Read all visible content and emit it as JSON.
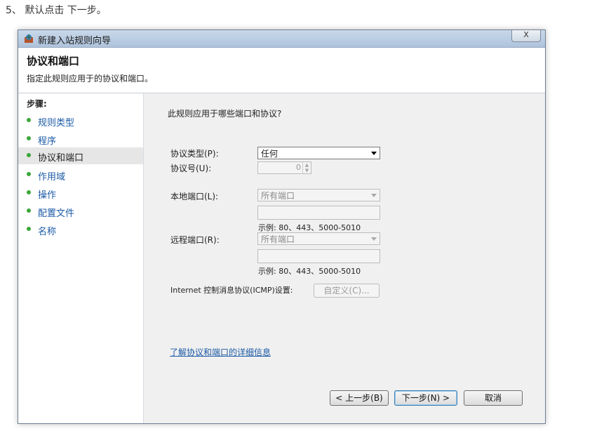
{
  "caption": "5、 默认点击 下一步。",
  "window": {
    "title": "新建入站规则向导",
    "close_label": "X"
  },
  "header": {
    "title": "协议和端口",
    "subtitle": "指定此规则应用于的协议和端口。"
  },
  "sidebar": {
    "steps_label": "步骤:",
    "items": [
      {
        "label": "规则类型",
        "active": false
      },
      {
        "label": "程序",
        "active": false
      },
      {
        "label": "协议和端口",
        "active": true
      },
      {
        "label": "作用域",
        "active": false
      },
      {
        "label": "操作",
        "active": false
      },
      {
        "label": "配置文件",
        "active": false
      },
      {
        "label": "名称",
        "active": false
      }
    ]
  },
  "main": {
    "question": "此规则应用于哪些端口和协议?",
    "protocol_type_label": "协议类型(P):",
    "protocol_type_value": "任何",
    "protocol_number_label": "协议号(U):",
    "protocol_number_value": "0",
    "local_port_label": "本地端口(L):",
    "local_port_value": "所有端口",
    "local_port_example": "示例: 80、443、5000-5010",
    "remote_port_label": "远程端口(R):",
    "remote_port_value": "所有端口",
    "remote_port_example": "示例: 80、443、5000-5010",
    "icmp_label": "Internet 控制消息协议(ICMP)设置:",
    "customize_label": "自定义(C)...",
    "learn_more_link": "了解协议和端口的详细信息"
  },
  "footer": {
    "back_label": "< 上一步(B)",
    "next_label": "下一步(N) >",
    "cancel_label": "取消"
  }
}
